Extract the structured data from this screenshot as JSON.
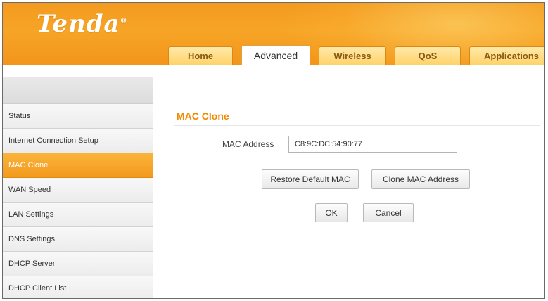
{
  "header": {
    "logo_text": "Tenda",
    "logo_mark": "®",
    "tabs": [
      {
        "label": "Home"
      },
      {
        "label": "Advanced"
      },
      {
        "label": "Wireless"
      },
      {
        "label": "QoS"
      },
      {
        "label": "Applications"
      }
    ],
    "active_tab": "Advanced"
  },
  "sidebar": {
    "items": [
      {
        "label": "Status"
      },
      {
        "label": "Internet Connection Setup"
      },
      {
        "label": "MAC Clone"
      },
      {
        "label": "WAN Speed"
      },
      {
        "label": "LAN Settings"
      },
      {
        "label": "DNS Settings"
      },
      {
        "label": "DHCP Server"
      },
      {
        "label": "DHCP Client List"
      }
    ],
    "active_item": "MAC Clone"
  },
  "main": {
    "section_title": "MAC Clone",
    "mac_address_label": "MAC Address",
    "mac_address_value": "C8:9C:DC:54:90:77",
    "restore_label": "Restore Default MAC",
    "clone_label": "Clone MAC Address",
    "ok_label": "OK",
    "cancel_label": "Cancel"
  },
  "colors": {
    "brand_orange": "#f7a526",
    "section_title": "#f08a00",
    "active_sidebar": "#f29a1e"
  }
}
